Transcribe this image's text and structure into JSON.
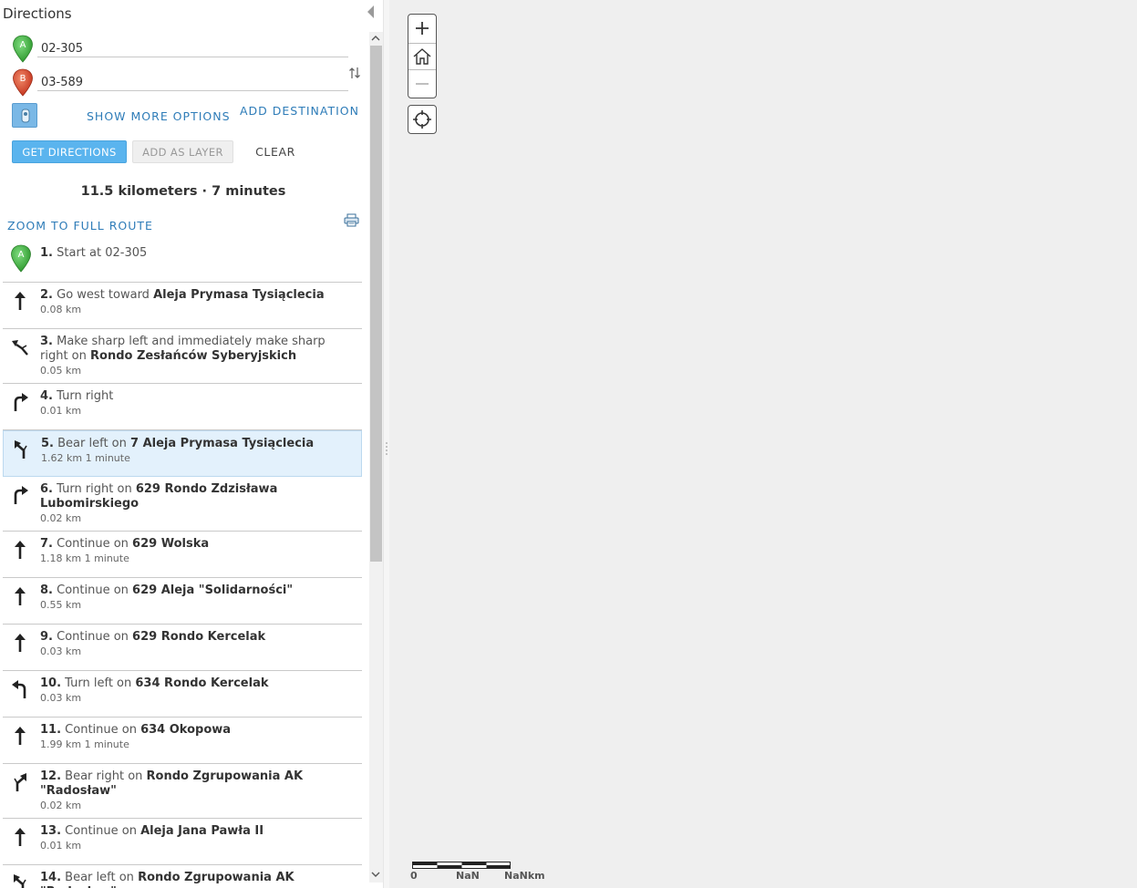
{
  "panel": {
    "title": "Directions",
    "stops": [
      {
        "letter": "A",
        "value": "02-305",
        "color": "#3aa63a"
      },
      {
        "letter": "B",
        "value": "03-589",
        "color": "#d0412a"
      }
    ],
    "show_more_options": "SHOW MORE OPTIONS",
    "add_destination": "ADD DESTINATION",
    "buttons": {
      "get_directions": "GET DIRECTIONS",
      "add_as_layer": "ADD AS LAYER",
      "clear": "CLEAR"
    },
    "summary": "11.5 kilometers · 7 minutes",
    "zoom_full_route": "ZOOM TO FULL ROUTE"
  },
  "steps": [
    {
      "num": "1.",
      "text": "Start at 02-305",
      "road": "",
      "sub": "",
      "icon": "pin-a-icon"
    },
    {
      "num": "2.",
      "text": "Go west toward",
      "road": "Aleja Prymasa Tysiąclecia",
      "sub": "0.08 km",
      "icon": "straight-arrow-icon"
    },
    {
      "num": "3.",
      "text": "Make sharp left and immediately make sharp right on",
      "road": "Rondo Zesłańców Syberyjskich",
      "sub": "0.05 km",
      "icon": "sharp-left-right-icon"
    },
    {
      "num": "4.",
      "text": "Turn right",
      "road": "",
      "sub": "0.01 km",
      "icon": "turn-right-icon"
    },
    {
      "num": "5.",
      "text": "Bear left on",
      "road": "7 Aleja Prymasa Tysiąclecia",
      "sub": "1.62 km 1 minute",
      "icon": "bear-left-icon"
    },
    {
      "num": "6.",
      "text": "Turn right on",
      "road": "629 Rondo Zdzisława Lubomirskiego",
      "sub": "0.02 km",
      "icon": "turn-right-icon"
    },
    {
      "num": "7.",
      "text": "Continue on",
      "road": "629 Wolska",
      "sub": "1.18 km 1 minute",
      "icon": "straight-arrow-icon"
    },
    {
      "num": "8.",
      "text": "Continue on",
      "road": "629 Aleja \"Solidarności\"",
      "sub": "0.55 km",
      "icon": "straight-arrow-icon"
    },
    {
      "num": "9.",
      "text": "Continue on",
      "road": "629 Rondo Kercelak",
      "sub": "0.03 km",
      "icon": "straight-arrow-icon"
    },
    {
      "num": "10.",
      "text": "Turn left on",
      "road": "634 Rondo Kercelak",
      "sub": "0.03 km",
      "icon": "turn-left-icon"
    },
    {
      "num": "11.",
      "text": "Continue on",
      "road": "634 Okopowa",
      "sub": "1.99 km 1 minute",
      "icon": "straight-arrow-icon"
    },
    {
      "num": "12.",
      "text": "Bear right on",
      "road": "Rondo Zgrupowania AK \"Radosław\"",
      "sub": "0.02 km",
      "icon": "bear-right-icon"
    },
    {
      "num": "13.",
      "text": "Continue on",
      "road": "Aleja Jana Pawła II",
      "sub": "0.01 km",
      "icon": "straight-arrow-icon"
    },
    {
      "num": "14.",
      "text": "Bear left on",
      "road": "Rondo Zgrupowania AK \"Radosław\"",
      "sub": "",
      "icon": "bear-left-icon"
    }
  ],
  "selected_step": 4,
  "map": {
    "zoom_in": "+",
    "zoom_out": "−",
    "scale_labels": [
      "0",
      "NaN",
      "NaNkm"
    ]
  }
}
